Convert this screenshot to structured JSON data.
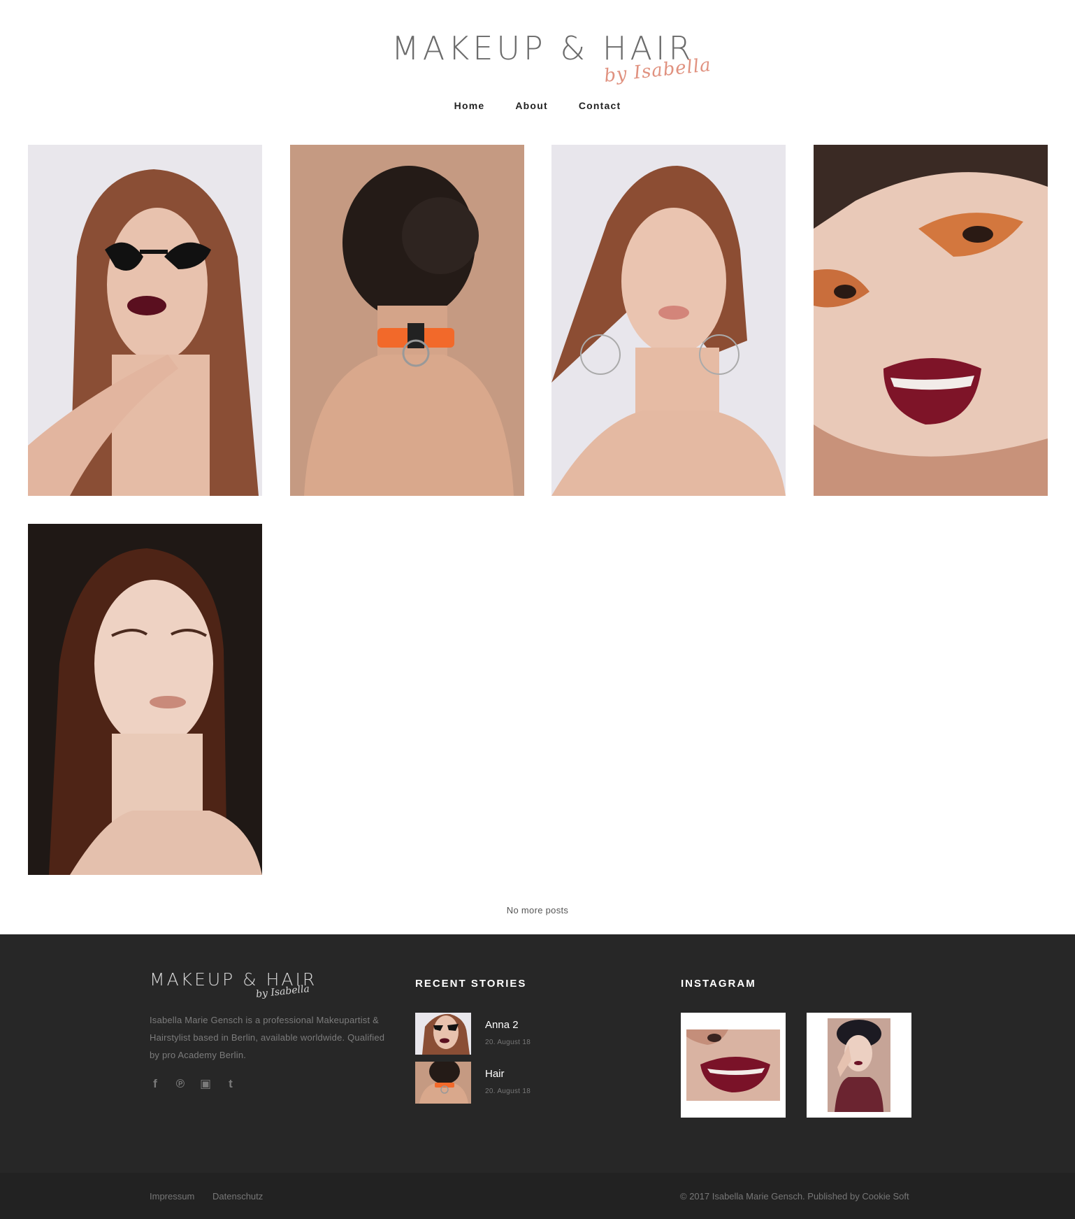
{
  "header": {
    "logo_main": "MAKEUP & HAIR",
    "logo_script": "by Isabella",
    "nav": [
      {
        "label": "Home"
      },
      {
        "label": "About"
      },
      {
        "label": "Contact"
      }
    ]
  },
  "gallery": {
    "items": [
      {
        "image": "model-with-cat-eye-sunglasses-and-dark-lips"
      },
      {
        "image": "back-view-hair-bun-orange-choker"
      },
      {
        "image": "redhead-model-with-hoop-earrings"
      },
      {
        "image": "closeup-orange-eyeshadow-red-lips"
      },
      {
        "image": "portrait-model-long-straight-hair"
      }
    ],
    "no_more_posts": "No more posts"
  },
  "footer": {
    "logo_main": "MAKEUP & HAIR",
    "logo_script": "by Isabella",
    "about_text": "Isabella Marie Gensch is a professional Makeupartist & Hairstylist based in Berlin, available worldwide. Qualified by pro Academy Berlin.",
    "social": [
      {
        "icon": "facebook-icon",
        "glyph": "f"
      },
      {
        "icon": "pinterest-icon",
        "glyph": "℗"
      },
      {
        "icon": "instagram-icon",
        "glyph": "▣"
      },
      {
        "icon": "tumblr-icon",
        "glyph": "t"
      }
    ],
    "recent_stories": {
      "heading": "RECENT STORIES",
      "items": [
        {
          "title": "Anna 2",
          "date": "20. August 18"
        },
        {
          "title": "Hair",
          "date": "20. August 18"
        }
      ]
    },
    "instagram": {
      "heading": "INSTAGRAM",
      "items": [
        {
          "image": "red-glossy-lips-closeup"
        },
        {
          "image": "model-with-black-hat"
        }
      ]
    },
    "bottom": {
      "impressum": "Impressum",
      "datenschutz": "Datenschutz",
      "copyright": "© 2017 Isabella Marie Gensch. Published by",
      "publisher": "Cookie Soft"
    }
  },
  "colors": {
    "accent": "#e0917f",
    "footer_bg": "#272727",
    "bottom_bar_bg": "#222222"
  }
}
